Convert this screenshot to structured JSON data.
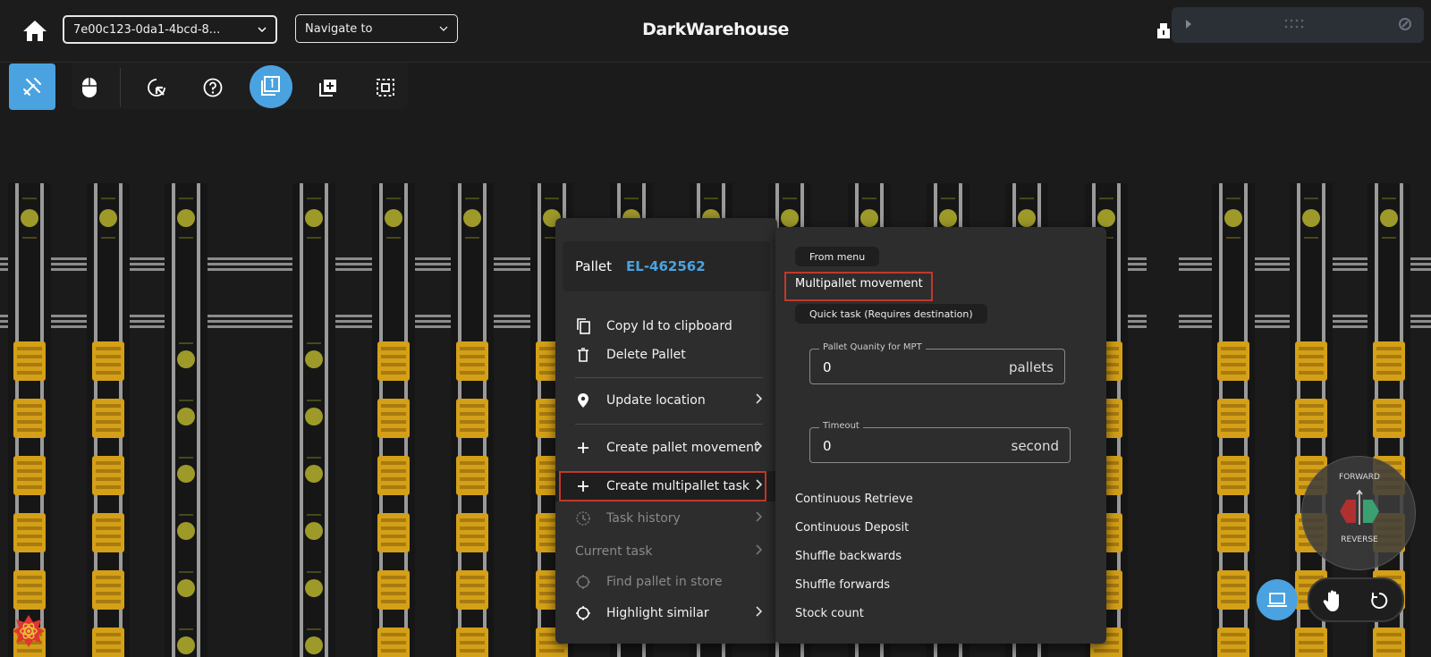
{
  "header": {
    "session_id": "7e00c123-0da1-4bcd-8...",
    "navigate_placeholder": "Navigate to",
    "app_title": "DarkWarehouse"
  },
  "toolbar": {
    "buttons": [
      "tools-icon",
      "mouse-icon",
      "select-pointer-icon",
      "help-icon",
      "layers-icon",
      "add-layer-icon",
      "select-area-icon"
    ]
  },
  "context_menu": {
    "pallet_label": "Pallet",
    "pallet_id": "EL-462562",
    "items": {
      "copy": "Copy Id to clipboard",
      "delete": "Delete Pallet",
      "update_location": "Update location",
      "create_pallet_movement": "Create pallet movement",
      "create_multipallet_task": "Create multipallet task",
      "task_history": "Task history",
      "current_task": "Current task",
      "find_pallet": "Find pallet in store",
      "highlight_similar": "Highlight similar"
    }
  },
  "submenu": {
    "from_menu": "From menu",
    "multipallet_movement": "Multipallet movement",
    "quick_task": "Quick task (Requires destination)",
    "pallet_qty": {
      "label": "Pallet Quanity for MPT",
      "value": "0",
      "unit": "pallets"
    },
    "timeout": {
      "label": "Timeout",
      "value": "0",
      "unit": "second"
    },
    "items": [
      "Continuous Retrieve",
      "Continuous Deposit",
      "Shuffle backwards",
      "Shuffle forwards",
      "Stock count"
    ]
  },
  "direction_control": {
    "forward": "FORWARD",
    "reverse": "REVERSE"
  },
  "colors": {
    "accent": "#4aa3e0",
    "highlight_border": "#c0392b",
    "pallet_yellow": "#d4a017",
    "shuttle_olive": "#9e9a2a"
  }
}
